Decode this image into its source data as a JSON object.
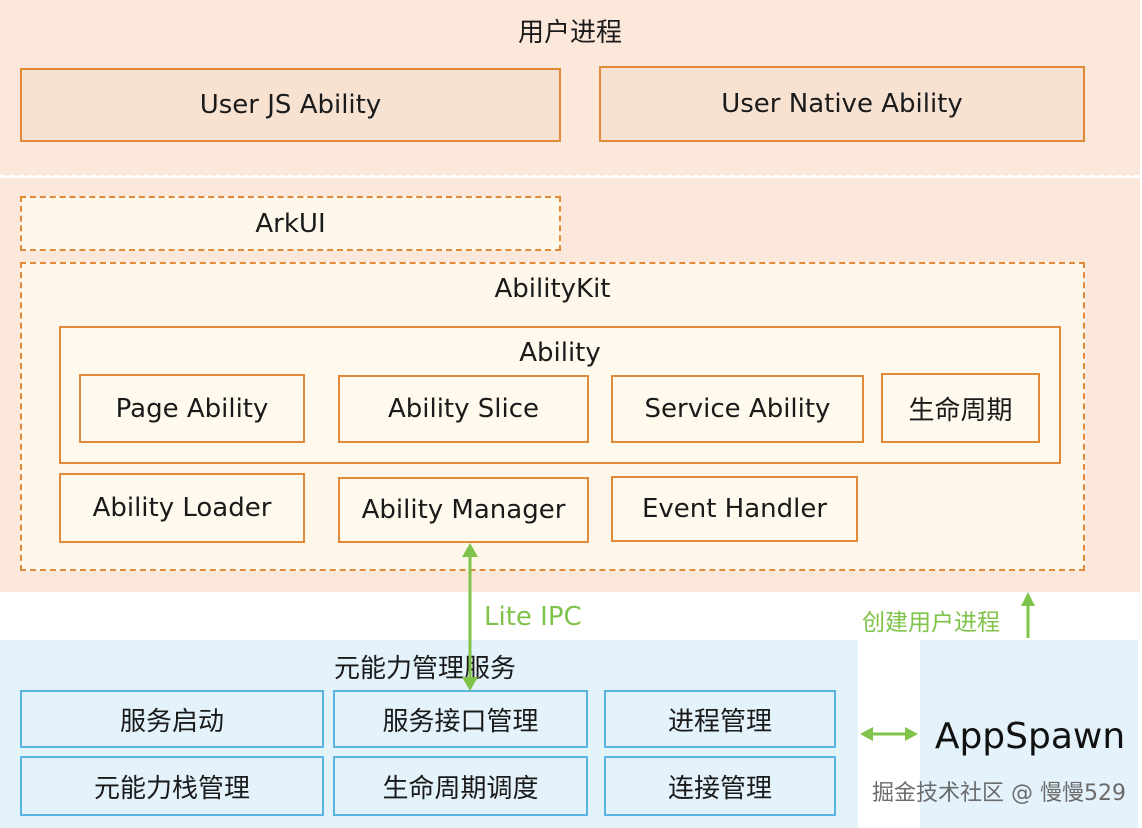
{
  "user_process": {
    "title": "用户进程",
    "user_js_ability": "User JS Ability",
    "user_native_ability": "User Native Ability"
  },
  "framework": {
    "arkui": "ArkUI",
    "abilitykit": "AbilityKit",
    "ability": {
      "title": "Ability",
      "items": [
        "Page Ability",
        "Ability Slice",
        "Service Ability",
        "生命周期"
      ]
    },
    "ability_loader": "Ability Loader",
    "ability_manager": "Ability Manager",
    "event_handler": "Event Handler"
  },
  "connectors": {
    "lite_ipc": "Lite IPC",
    "create_user_process": "创建用户进程"
  },
  "service": {
    "title": "元能力管理服务",
    "items": [
      "服务启动",
      "服务接口管理",
      "进程管理",
      "元能力栈管理",
      "生命周期调度",
      "连接管理"
    ]
  },
  "appspawn": "AppSpawn",
  "watermark": "掘金技术社区 @ 慢慢529",
  "colors": {
    "orange_border": "#e08a3a",
    "peach_background": "#fce8db",
    "blue_border": "#5bb4e0",
    "blue_background": "#e4f2fb",
    "green_arrow": "#7fc34a"
  }
}
